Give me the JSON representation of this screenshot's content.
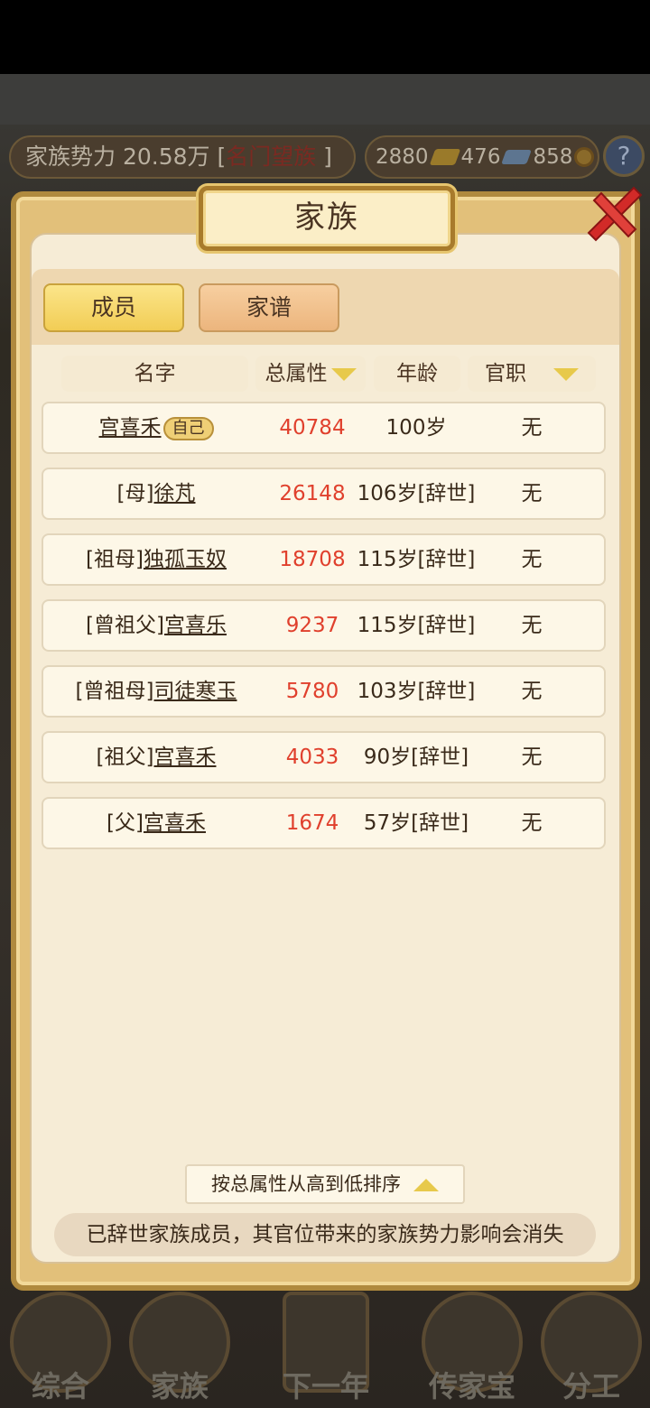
{
  "resource_bar": {
    "power_label": "家族势力 20.58万 [",
    "power_rank": "名门望族",
    "power_suffix": " ]",
    "gold": "2880",
    "silver": "476",
    "coins": "858",
    "help": "?"
  },
  "modal": {
    "title": "家族",
    "tabs": [
      {
        "label": "成员"
      },
      {
        "label": "家谱"
      }
    ],
    "columns": {
      "name": "名字",
      "attr": "总属性",
      "age": "年龄",
      "post": "官职"
    },
    "rows": [
      {
        "prefix": "",
        "name": "宫喜禾",
        "badge": "自己",
        "attr": "40784",
        "age": "100岁",
        "post": "无"
      },
      {
        "prefix": "[母]",
        "name": "徐芃",
        "badge": "",
        "attr": "26148",
        "age": "106岁[辞世]",
        "post": "无"
      },
      {
        "prefix": "[祖母]",
        "name": "独孤玉奴",
        "badge": "",
        "attr": "18708",
        "age": "115岁[辞世]",
        "post": "无"
      },
      {
        "prefix": "[曾祖父]",
        "name": "宫喜乐",
        "badge": "",
        "attr": "9237",
        "age": "115岁[辞世]",
        "post": "无"
      },
      {
        "prefix": "[曾祖母]",
        "name": "司徒寒玉",
        "badge": "",
        "attr": "5780",
        "age": "103岁[辞世]",
        "post": "无"
      },
      {
        "prefix": "[祖父]",
        "name": "宫喜禾",
        "badge": "",
        "attr": "4033",
        "age": "90岁[辞世]",
        "post": "无"
      },
      {
        "prefix": "[父]",
        "name": "宫喜禾",
        "badge": "",
        "attr": "1674",
        "age": "57岁[辞世]",
        "post": "无"
      }
    ],
    "sort_label": "按总属性从高到低排序",
    "notice": "已辞世家族成员，其官位带来的家族势力影响会消失"
  },
  "bottom_nav": [
    {
      "label": "综合"
    },
    {
      "label": "家族"
    },
    {
      "label": "下一年"
    },
    {
      "label": "传家宝"
    },
    {
      "label": "分工"
    }
  ],
  "colors": {
    "accent_red": "#e0402d",
    "gold": "#e7c94b",
    "panel": "#f6ecd6"
  }
}
